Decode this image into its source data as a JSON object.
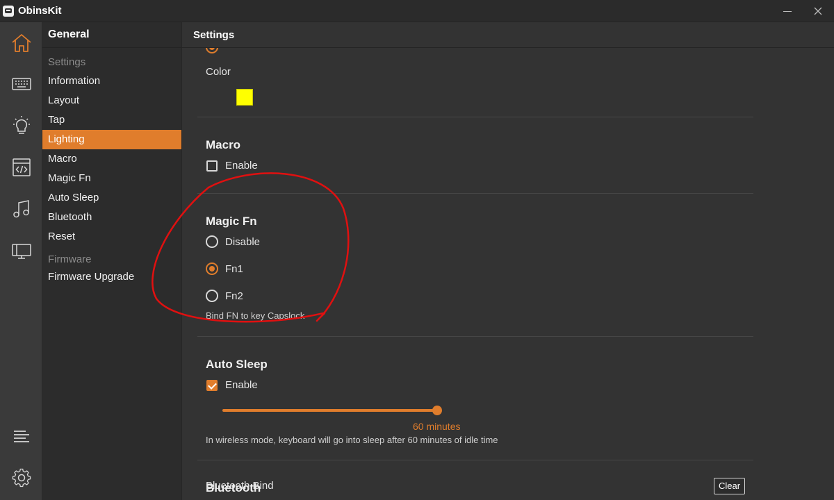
{
  "app": {
    "title": "ObinsKit"
  },
  "rail": {
    "items": [
      {
        "icon": "home-icon",
        "active": true
      },
      {
        "icon": "keyboard-icon"
      },
      {
        "icon": "lightbulb-icon"
      },
      {
        "icon": "code-icon"
      },
      {
        "icon": "music-icon"
      },
      {
        "icon": "monitor-icon"
      }
    ],
    "bottom": [
      {
        "icon": "menu-lines-icon"
      },
      {
        "icon": "gear-icon"
      }
    ]
  },
  "nav": {
    "heading": "General",
    "groups": [
      {
        "label": "Settings",
        "items": [
          "Information",
          "Layout",
          "Tap",
          "Lighting",
          "Macro",
          "Magic Fn",
          "Auto Sleep",
          "Bluetooth",
          "Reset"
        ]
      },
      {
        "label": "Firmware",
        "items": [
          "Firmware Upgrade"
        ]
      }
    ],
    "active_item": "Lighting"
  },
  "main": {
    "title": "Settings",
    "lighting": {
      "color_label": "Color",
      "color_value": "#ffff00"
    },
    "macro": {
      "title": "Macro",
      "enable_label": "Enable",
      "enabled": false
    },
    "magic_fn": {
      "title": "Magic Fn",
      "options": [
        "Disable",
        "Fn1",
        "Fn2"
      ],
      "selected": "Fn1",
      "hint": "Bind FN to key Capslock"
    },
    "auto_sleep": {
      "title": "Auto Sleep",
      "enable_label": "Enable",
      "enabled": true,
      "slider_value": "60 minutes",
      "hint": "In wireless mode, keyboard will go into sleep after 60 minutes of idle time"
    },
    "bluetooth": {
      "title": "Bluetooth",
      "bind_label": "Bluetooth Bind",
      "clear_label": "Clear"
    }
  },
  "colors": {
    "accent": "#e07d2c",
    "annotation": "#e01010"
  }
}
